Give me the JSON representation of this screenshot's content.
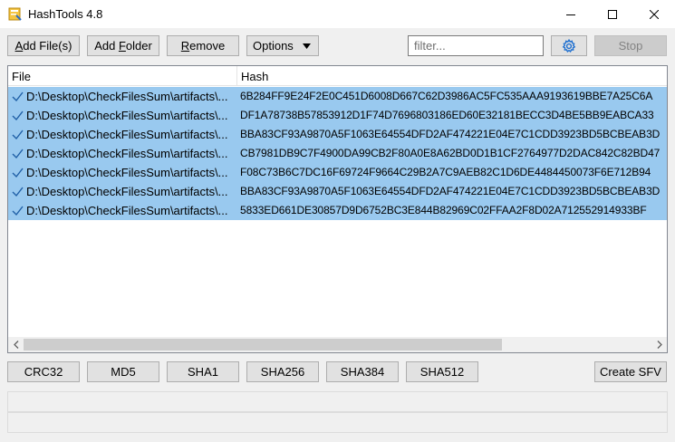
{
  "window": {
    "title": "HashTools 4.8",
    "icon": "hashtools-app-icon",
    "controls": [
      "minimize-icon",
      "maximize-icon",
      "close-icon"
    ]
  },
  "toolbar": {
    "add_files_label": "Add File(s)",
    "add_files_accel": "A",
    "add_files_rest": "dd File(s)",
    "add_folder_label": "Add Folder",
    "add_folder_pre": "Add ",
    "add_folder_accel": "F",
    "add_folder_rest": "older",
    "remove_label": "Remove",
    "remove_accel": "R",
    "remove_rest": "emove",
    "options_label": "Options",
    "filter_placeholder": "filter...",
    "filter_value": "",
    "settings_icon": "gear-icon",
    "stop_label": "Stop",
    "stop_enabled": false
  },
  "list": {
    "columns": [
      "File",
      "Hash"
    ],
    "rows": [
      {
        "checked": true,
        "file": "D:\\Desktop\\CheckFilesSum\\artifacts\\...",
        "hash": "6B284FF9E24F2E0C451D6008D667C62D3986AC5FC535AAA9193619BBE7A25C6A"
      },
      {
        "checked": true,
        "file": "D:\\Desktop\\CheckFilesSum\\artifacts\\...",
        "hash": "DF1A78738B57853912D1F74D7696803186ED60E32181BECC3D4BE5BB9EABCA33"
      },
      {
        "checked": true,
        "file": "D:\\Desktop\\CheckFilesSum\\artifacts\\...",
        "hash": "BBA83CF93A9870A5F1063E64554DFD2AF474221E04E7C1CDD3923BD5BCBEAB3D"
      },
      {
        "checked": true,
        "file": "D:\\Desktop\\CheckFilesSum\\artifacts\\...",
        "hash": "CB7981DB9C7F4900DA99CB2F80A0E8A62BD0D1B1CF2764977D2DAC842C82BD47"
      },
      {
        "checked": true,
        "file": "D:\\Desktop\\CheckFilesSum\\artifacts\\...",
        "hash": "F08C73B6C7DC16F69724F9664C29B2A7C9AEB82C1D6DE4484450073F6E712B94"
      },
      {
        "checked": true,
        "file": "D:\\Desktop\\CheckFilesSum\\artifacts\\...",
        "hash": "BBA83CF93A9870A5F1063E64554DFD2AF474221E04E7C1CDD3923BD5BCBEAB3D"
      },
      {
        "checked": true,
        "file": "D:\\Desktop\\CheckFilesSum\\artifacts\\...",
        "hash": "5833ED661DE30857D9D6752BC3E844B82969C02FFAA2F8D02A712552914933BF"
      }
    ],
    "scrollbar": {
      "left_icon": "chevron-left-icon",
      "right_icon": "chevron-right-icon"
    }
  },
  "hash_buttons": [
    "CRC32",
    "MD5",
    "SHA1",
    "SHA256",
    "SHA384",
    "SHA512"
  ],
  "create_sfv_label": "Create SFV",
  "status": {
    "line1": "",
    "line2": ""
  },
  "colors": {
    "selection": "#99c9ef",
    "check": "#1f5fa6",
    "button_face": "#e1e1e1",
    "settings_icon": "#1e6fd0"
  }
}
